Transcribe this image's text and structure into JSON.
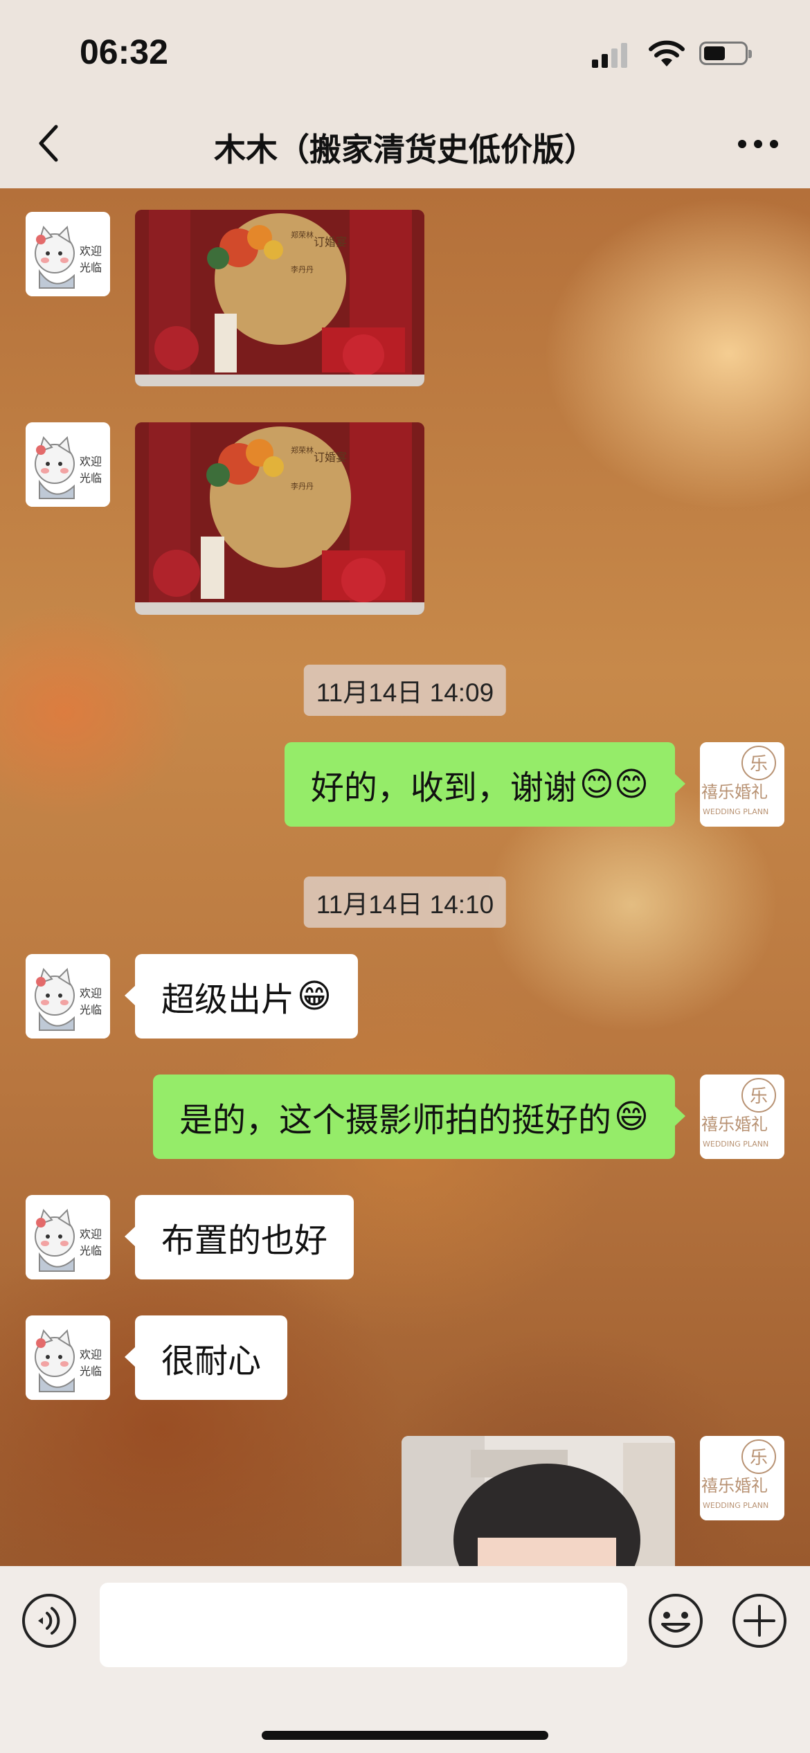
{
  "status_bar": {
    "time": "06:32"
  },
  "header": {
    "title": "木木（搬家清货史低价版）"
  },
  "contacts": {
    "left_avatar_text": [
      "欢迎",
      "光临"
    ],
    "right_avatar_text": "禧乐婚礼",
    "right_avatar_subtext": "WEDDING PLANN"
  },
  "photo_text": {
    "board_title": "订婚宴",
    "sign_left": "郑荣林",
    "sign_right": "李丹丹"
  },
  "messages": [
    {
      "id": "m1",
      "side": "left",
      "type": "image"
    },
    {
      "id": "m2",
      "side": "left",
      "type": "image"
    },
    {
      "id": "t1",
      "type": "timestamp",
      "text": "11月14日 14:09"
    },
    {
      "id": "m3",
      "side": "right",
      "type": "text",
      "text": "好的，收到，谢谢",
      "emoji": "😊😊"
    },
    {
      "id": "t2",
      "type": "timestamp",
      "text": "11月14日 14:10"
    },
    {
      "id": "m4",
      "side": "left",
      "type": "text",
      "text": "超级出片",
      "emoji": "😁"
    },
    {
      "id": "m5",
      "side": "right",
      "type": "text",
      "text": "是的，这个摄影师拍的挺好的",
      "emoji": "😄"
    },
    {
      "id": "m6",
      "side": "left",
      "type": "text",
      "text": "布置的也好"
    },
    {
      "id": "m7",
      "side": "left",
      "type": "text",
      "text": "很耐心"
    },
    {
      "id": "m8",
      "side": "right",
      "type": "image"
    }
  ],
  "input_bar": {
    "value": "",
    "placeholder": ""
  },
  "colors": {
    "outgoing_bubble": "#95ec69",
    "incoming_bubble": "#ffffff",
    "header_bg": "#ece4dd"
  }
}
